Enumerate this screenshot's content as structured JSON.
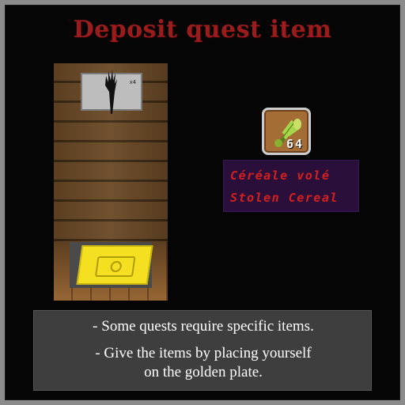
{
  "title": "Deposit quest item",
  "item": {
    "icon": "stolen-cereal-icon",
    "count": "64",
    "name_fr": "Céréale volé",
    "name_en": "Stolen Cereal"
  },
  "info": {
    "line1": "- Some quests require specific items.",
    "line2a": "- Give the items by placing yourself",
    "line2b": "on the golden plate."
  },
  "scene": {
    "frame_mark": "x4"
  },
  "colors": {
    "title": "#9b1c1c",
    "item_label": "#d42020",
    "label_bg": "#2a0f3a",
    "plate": "#f4e020"
  }
}
